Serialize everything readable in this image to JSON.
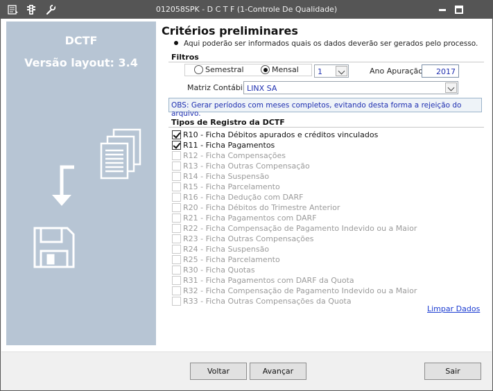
{
  "titlebar": {
    "title": "012058SPK - D C T F (1-Controle De Qualidade)",
    "icons": [
      "menu-icon",
      "traffic-light-icon",
      "wrench-icon"
    ],
    "buttons": [
      "minimize-icon",
      "restore-icon"
    ]
  },
  "sidebar": {
    "title": "DCTF",
    "subtitle": "Versão layout: 3.4",
    "icons": [
      "documents-icon",
      "arrow-down-icon",
      "floppy-disk-icon"
    ]
  },
  "main": {
    "heading": "Critérios preliminares",
    "bullet": "Aqui poderão ser informados quais os dados deverão ser gerados pelo processo.",
    "filters": {
      "label": "Filtros",
      "semestral_label": "Semestral",
      "mensal_label": "Mensal",
      "selected": "Mensal",
      "period_value": "1",
      "ano_label": "Ano Apuração:",
      "ano_value": "2017",
      "matriz_label": "Matriz Contábil:",
      "matriz_value": "LINX SA"
    },
    "obs": "OBS: Gerar períodos com meses completos, evitando desta forma a rejeição do arquivo.",
    "registros": {
      "label": "Tipos de Registro da DCTF",
      "items": [
        {
          "label": "R10 - Ficha Débitos apurados e créditos vinculados",
          "checked": true,
          "enabled": true
        },
        {
          "label": "R11 - Ficha Pagamentos",
          "checked": true,
          "enabled": true
        },
        {
          "label": "R12 - Ficha Compensações",
          "checked": false,
          "enabled": false
        },
        {
          "label": "R13 - Ficha Outras Compensação",
          "checked": false,
          "enabled": false
        },
        {
          "label": "R14 - Ficha Suspensão",
          "checked": false,
          "enabled": false
        },
        {
          "label": "R15 - Ficha Parcelamento",
          "checked": false,
          "enabled": false
        },
        {
          "label": "R16 - Ficha Dedução com DARF",
          "checked": false,
          "enabled": false
        },
        {
          "label": "R20 - Ficha Débitos do Trimestre Anterior",
          "checked": false,
          "enabled": false
        },
        {
          "label": "R21 - Ficha Pagamentos com DARF",
          "checked": false,
          "enabled": false
        },
        {
          "label": "R22 - Ficha Compensação de Pagamento Indevido ou a Maior",
          "checked": false,
          "enabled": false
        },
        {
          "label": "R23 - Ficha Outras Compensações",
          "checked": false,
          "enabled": false
        },
        {
          "label": "R24 - Ficha Suspensão",
          "checked": false,
          "enabled": false
        },
        {
          "label": "R25 - Ficha Parcelamento",
          "checked": false,
          "enabled": false
        },
        {
          "label": "R30 - Ficha Quotas",
          "checked": false,
          "enabled": false
        },
        {
          "label": "R31 - Ficha Pagamentos com DARF da Quota",
          "checked": false,
          "enabled": false
        },
        {
          "label": "R32 - Ficha Compensação de Pagamento Indevido ou a Maior",
          "checked": false,
          "enabled": false
        },
        {
          "label": "R33 - Ficha Outras Compensações da Quota",
          "checked": false,
          "enabled": false
        }
      ]
    },
    "clear_link": "Limpar Dados"
  },
  "footer": {
    "back_label": "Voltar",
    "next_label": "Avançar",
    "exit_label": "Sair"
  },
  "colors": {
    "titlebar": "#555555",
    "sidebar": "#b7c5d4",
    "accent_text": "#1e2fb0",
    "link": "#1a3bd1"
  }
}
